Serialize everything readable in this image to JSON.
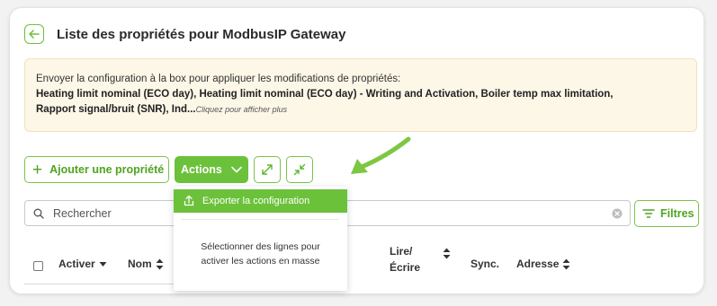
{
  "header": {
    "title": "Liste des propriétés pour ModbusIP Gateway"
  },
  "notice": {
    "line1": "Envoyer la configuration à la box pour appliquer les modifications de propriétés:",
    "bold_line2": "Heating limit nominal (ECO day), Heating limit nominal (ECO day) - Writing and Activation, Boiler temp max limitation,",
    "bold_line3": "Rapport signal/bruit (SNR), Ind...",
    "more_link": "Cliquez pour afficher plus"
  },
  "toolbar": {
    "add_label": "Ajouter une propriété",
    "actions_label": "Actions"
  },
  "dropdown": {
    "export_label": "Exporter la configuration",
    "message_line1": "Sélectionner des lignes pour",
    "message_line2": "activer les actions en masse"
  },
  "search": {
    "placeholder": "Rechercher",
    "filters_label": "Filtres"
  },
  "table": {
    "headers": {
      "activer": "Activer",
      "nom": "Nom",
      "lire_line1": "Lire/",
      "lire_line2": "Écrire",
      "sync": "Sync.",
      "adresse": "Adresse"
    }
  },
  "colors": {
    "accent": "#6cc13b",
    "accent_dark": "#4fa420",
    "notice_bg": "#fdf7e8"
  }
}
